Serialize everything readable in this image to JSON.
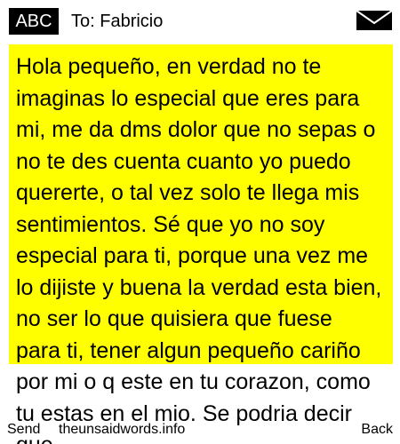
{
  "header": {
    "mode_label": "ABC",
    "recipient": "To: Fabricio",
    "message_icon": "envelope-icon"
  },
  "message": {
    "body": "Hola pequeño, en verdad no te imaginas lo especial que eres para mi, me da dms dolor que no sepas o no te des cuenta cuanto yo puedo quererte, o tal vez solo te llega mis sentimientos. Sé que yo no soy especial para ti, porque una vez me lo dijiste y buena la verdad esta bien, no ser lo que quisiera que fuese para ti, tener algun pequeño cariño por mi o q este en tu corazon, como tu estas en el mio. Se podria decir que",
    "highlight_color": "#ffff00"
  },
  "footer": {
    "left_softkey": "Send",
    "watermark": "theunsaidwords.info",
    "right_softkey": "Back"
  }
}
